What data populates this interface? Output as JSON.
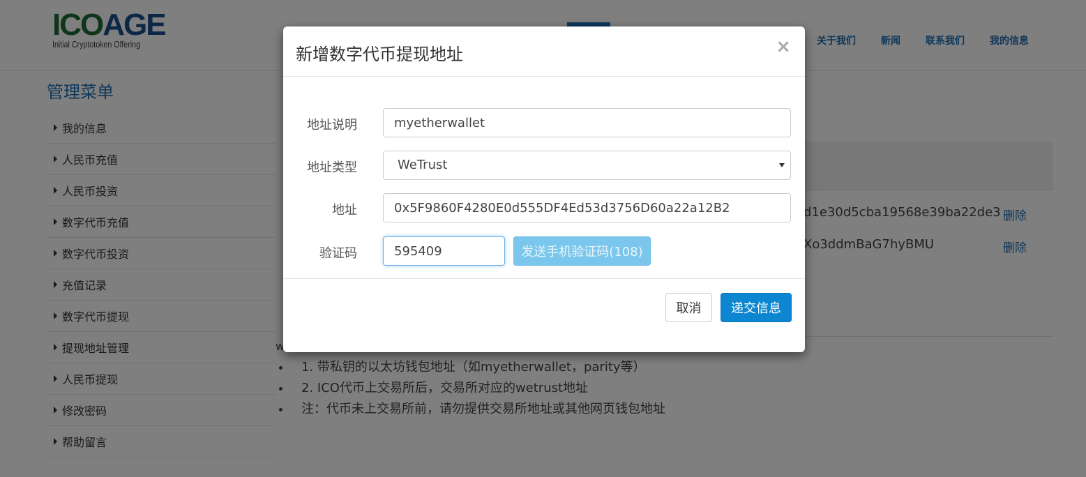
{
  "brand": {
    "logo_part1": "ICO",
    "logo_part2": "AGE",
    "tagline": "Initial Cryptotoken Offering"
  },
  "nav": {
    "items": [
      "关于我们",
      "新闻",
      "联系我们",
      "我的信息"
    ]
  },
  "sidebar": {
    "title": "管理菜单",
    "items": [
      "我的信息",
      "人民币充值",
      "人民币投资",
      "数字代币充值",
      "数字代币投资",
      "充值记录",
      "数字代币提现",
      "提现地址管理",
      "人民币提现",
      "修改密码",
      "帮助留言"
    ]
  },
  "address_table": {
    "rows": [
      {
        "address_partial": "d1e30d5cba19568e39ba22de3",
        "action": "删除"
      },
      {
        "address_partial": "Xo3ddmBaG7hyBMU",
        "action": "删除"
      }
    ]
  },
  "notes": {
    "prefix": "w",
    "items": [
      "1. 带私钥的以太坊钱包地址（如myetherwallet，parity等）",
      "2. ICO代币上交易所后，交易所对应的wetrust地址",
      "注：代币未上交易所前，请勿提供交易所地址或其他网页钱包地址"
    ]
  },
  "modal": {
    "title": "新增数字代币提现地址",
    "close": "×",
    "fields": {
      "description": {
        "label": "地址说明",
        "value": "myetherwallet"
      },
      "type": {
        "label": "地址类型",
        "value": "WeTrust"
      },
      "address": {
        "label": "地址",
        "value": "0x5F9860F4280E0d555DF4Ed53d3756D60a22a12B2"
      },
      "code": {
        "label": "验证码",
        "value": "595409"
      }
    },
    "sms_button": "发送手机验证码(108)",
    "cancel": "取消",
    "submit": "递交信息"
  }
}
